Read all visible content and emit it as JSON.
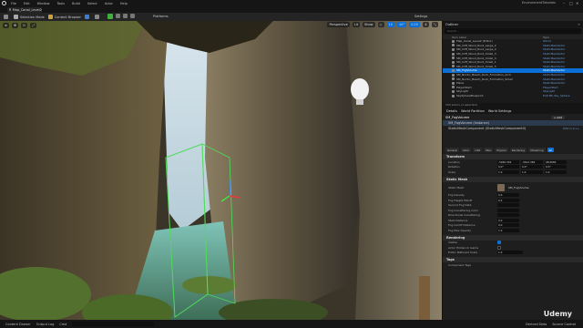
{
  "menubar": {
    "items": [
      "File",
      "Edit",
      "Window",
      "Tools",
      "Build",
      "Select",
      "Actor",
      "Help"
    ],
    "project_name": "EnvironmentTutorials",
    "minimize": "–",
    "maximize": "□",
    "close": "✕"
  },
  "tabbar": {
    "level_tab": "Map_Canal_Level2"
  },
  "toolbar": {
    "save": "",
    "selection_mode": "Selection Mode",
    "content_browser": "Content Browser",
    "blueprints": "",
    "cinematics": "",
    "platforms": "Platforms",
    "settings": "Settings"
  },
  "viewport": {
    "menu": "≡",
    "perspective": "Perspective",
    "lit": "Lit",
    "show": "Show",
    "grid_value": "10",
    "rot_value": "10°",
    "scale_value": "0.25",
    "cam_speed": "4"
  },
  "outliner": {
    "tab_title": "Outliner",
    "search_placeholder": "Search...",
    "col_label": "Item Label",
    "col_type": "Type",
    "rows": [
      {
        "label": "Map_Canal_Level2 (Editor)",
        "type": "World"
      },
      {
        "label": "SM_Cliff_Wood_Rock_Large_2",
        "type": "StaticMeshActor"
      },
      {
        "label": "SM_Cliff_Wood_Rock_Large_4",
        "type": "StaticMeshActor"
      },
      {
        "label": "SM_Cliff_Wood_Rock_Small_3",
        "type": "StaticMeshActor"
      },
      {
        "label": "SM_Cliff_Wood_Rock_Small_4",
        "type": "StaticMeshActor"
      },
      {
        "label": "SM_Cliff_Wood_Rock_Small_1",
        "type": "StaticMeshActor"
      },
      {
        "label": "SM_Cliff_Wood_Rock_Small_5",
        "type": "StaticMeshActor"
      },
      {
        "label": "SM_FogVolume",
        "type": "StaticMeshActor"
      },
      {
        "label": "SM_Nordic_Beach_Rock_Formation_Arch",
        "type": "StaticMeshActor"
      },
      {
        "label": "SM_Nordic_Beach_Rock_Formation_Small",
        "type": "StaticMeshActor"
      },
      {
        "label": "Plane",
        "type": "StaticMeshActor"
      },
      {
        "label": "PlayerStart",
        "type": "PlayerStart"
      },
      {
        "label": "SkyLight",
        "type": "SkyLight"
      },
      {
        "label": "SkySphereBlueprint",
        "type": "Edit BP_Sky_Sphere"
      }
    ],
    "selected_index": 7,
    "footer": "153 actors (1 selected)"
  },
  "details": {
    "tabs": [
      "Details",
      "World Partition",
      "World Settings"
    ],
    "actor": "SM_FogVolume",
    "add_label": "+ Add",
    "components": [
      {
        "label": "SM_FogVolume (Instance)",
        "link": ""
      },
      {
        "label": "StaticMeshComponent (StaticMeshComponent0)",
        "link": "Edit in C++"
      }
    ],
    "filters": [
      "General",
      "Actor",
      "LOD",
      "Misc",
      "Physics",
      "Rendering",
      "Streaming",
      "All"
    ],
    "active_filter": "All",
    "transform": {
      "section": "Transform",
      "location_label": "Location",
      "location": [
        "-5940.302",
        "-3612.384",
        "98.6082"
      ],
      "rotation_label": "Rotation",
      "rotation": [
        "0.0°",
        "0.0°",
        "0.0°"
      ],
      "scale_label": "Scale",
      "scale": [
        "1.0",
        "1.0",
        "1.0"
      ]
    },
    "static_mesh": {
      "section": "Static Mesh",
      "mesh_label": "Static Mesh",
      "mesh_value": "SM_FogVolume"
    },
    "props": [
      {
        "label": "Fog Density",
        "value": "0.0"
      },
      {
        "label": "Fog Height Falloff",
        "value": "0.2"
      },
      {
        "label": "Second Fog Data",
        "value": ""
      },
      {
        "label": "Fog Inscattering Color",
        "value": ""
      },
      {
        "label": "Directional Inscattering",
        "value": ""
      },
      {
        "label": "Start Distance",
        "value": "0.0"
      },
      {
        "label": "Fog Cutoff Distance",
        "value": "0.0"
      },
      {
        "label": "Fog Max Opacity",
        "value": "1.0"
      }
    ],
    "rendering": {
      "section": "Rendering",
      "visible_label": "Visible",
      "actor_hidden_label": "Actor Hidden In Game",
      "editor_billboard_label": "Editor Billboard Scale",
      "editor_billboard_value": "1.0"
    },
    "tags": {
      "section": "Tags",
      "label": "Component Tags"
    }
  },
  "status": {
    "content_drawer": "Content Drawer",
    "output_log": "Output Log",
    "cmd": "Cmd",
    "cmd_placeholder": "Enter Console Command",
    "derived_data": "Derived Data",
    "source_control": "Source Control"
  },
  "watermark": "Udemy",
  "colors": {
    "accent": "#0a6fd6",
    "panel_bg": "#1e1e1e",
    "play_green": "#3fb03f"
  }
}
